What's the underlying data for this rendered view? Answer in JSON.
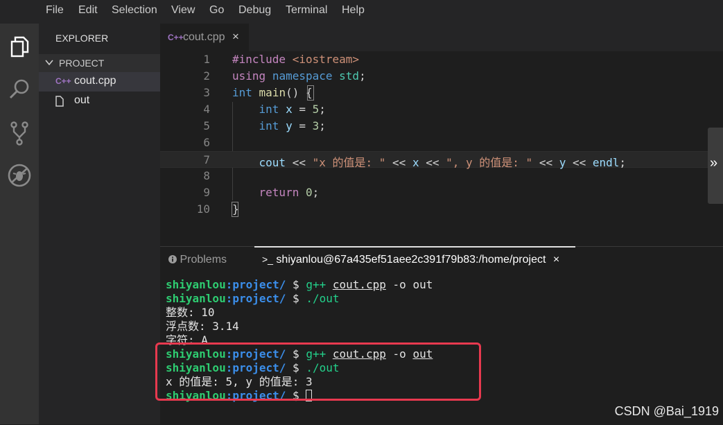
{
  "menu": [
    "File",
    "Edit",
    "Selection",
    "View",
    "Go",
    "Debug",
    "Terminal",
    "Help"
  ],
  "activity_icons": [
    "files-icon",
    "search-icon",
    "source-control-icon",
    "debug-icon"
  ],
  "sidebar": {
    "title": "EXPLORER",
    "section": "PROJECT",
    "files": [
      {
        "name": "cout.cpp",
        "icon": "C++",
        "icon_color": "#a074c4"
      },
      {
        "name": "out",
        "icon": "file-icon"
      }
    ]
  },
  "tab": {
    "icon": "C++",
    "name": "cout.cpp",
    "close": "×"
  },
  "editor": {
    "line_numbers": [
      "1",
      "2",
      "3",
      "4",
      "5",
      "6",
      "7",
      "8",
      "9",
      "10"
    ],
    "lines": [
      "#include <iostream>",
      "using namespace std;",
      "int main() {",
      "    int x = 5;",
      "    int y = 3;",
      "",
      "    cout << \"x 的值是: \" << x << \", y 的值是: \" << y << endl;",
      "",
      "    return 0;",
      "}"
    ]
  },
  "panel": {
    "problems_tab": "Problems",
    "terminal_tab": "shiyanlou@67a435ef51aee2c391f79b83:/home/project",
    "terminal_prefix": ">_",
    "close": "×"
  },
  "terminal": {
    "user": "shiyanlou",
    "path": ":project/",
    "prompt": " $ ",
    "cmd_compile_a": "g++ ",
    "cmd_compile_file": "cout.cpp",
    "cmd_compile_b": " -o ",
    "cmd_compile_out": "out",
    "cmd_run": "./out",
    "output_1": [
      "整数: 10",
      "浮点数: 3.14",
      "字符: A"
    ],
    "output_2": "x 的值是: 5, y 的值是: 3"
  },
  "watermark": "CSDN @Bai_1919",
  "colors": {
    "highlight_box": "#e8394f",
    "username": "#2ecc71",
    "path": "#3b8eea"
  }
}
